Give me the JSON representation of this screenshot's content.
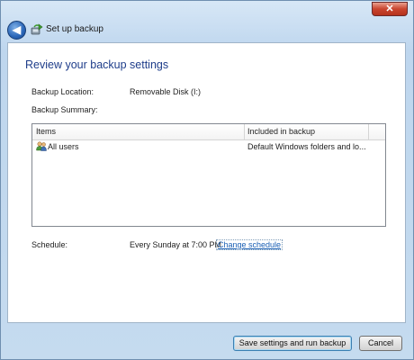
{
  "window": {
    "title": "Set up backup",
    "close_glyph": "✕"
  },
  "nav": {
    "back_glyph": "◀"
  },
  "page": {
    "heading": "Review your backup settings",
    "backup_location_label": "Backup Location:",
    "backup_location_value": "Removable Disk (I:)",
    "backup_summary_label": "Backup Summary:",
    "table": {
      "columns": [
        "Items",
        "Included in backup"
      ],
      "rows": [
        {
          "item": "All users",
          "included": "Default Windows folders and lo..."
        }
      ]
    },
    "schedule_label": "Schedule:",
    "schedule_value": "Every Sunday at 7:00 PM",
    "change_schedule_link": "Change schedule"
  },
  "buttons": {
    "save_run": "Save settings and run backup",
    "cancel": "Cancel"
  },
  "colors": {
    "heading": "#1e3d8a",
    "link": "#1a5fb4",
    "accent": "#2a66b8"
  },
  "icons": {
    "back": "back-arrow-icon",
    "app": "backup-app-icon",
    "users": "users-icon",
    "close": "close-icon"
  }
}
